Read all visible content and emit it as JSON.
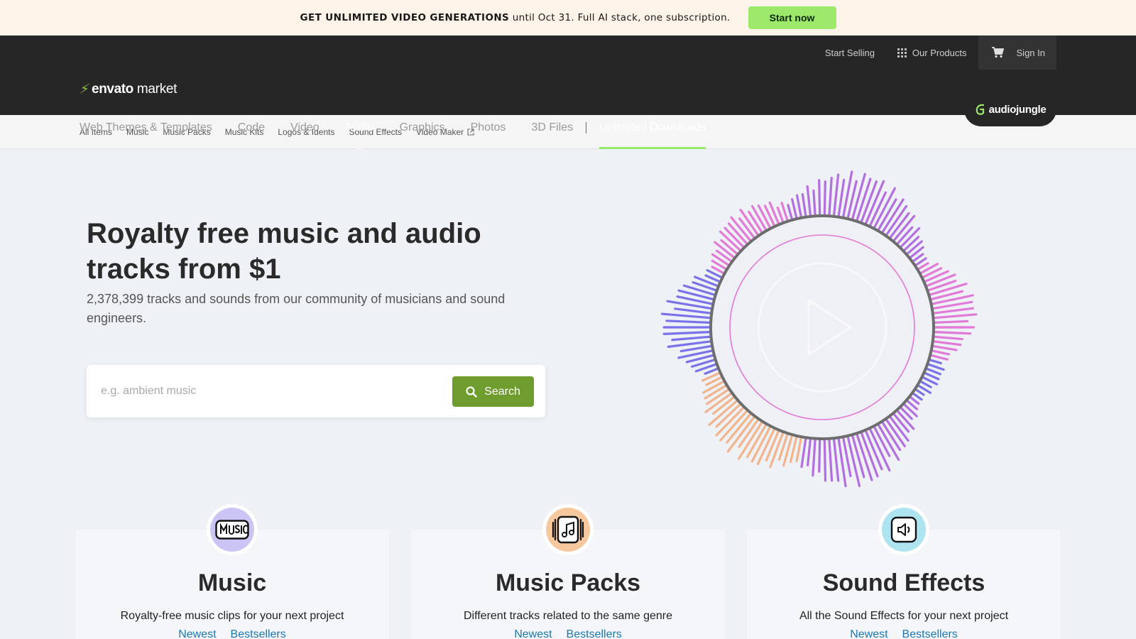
{
  "promo": {
    "headline": "GET UNLIMITED VIDEO GENERATIONS",
    "detail": "until Oct 31. Full AI stack, one subscription.",
    "cta": "Start now"
  },
  "brand": {
    "logo_bold": "envato",
    "logo_light": "market",
    "site_badge": "audiojungle"
  },
  "top_links": {
    "start_selling": "Start Selling",
    "our_products": "Our Products",
    "sign_in": "Sign In"
  },
  "main_nav": [
    {
      "label": "Web Themes & Templates"
    },
    {
      "label": "Code"
    },
    {
      "label": "Video"
    },
    {
      "label": "Audio",
      "active": true
    },
    {
      "label": "Graphics"
    },
    {
      "label": "Photos"
    },
    {
      "label": "3D Files"
    },
    {
      "label": "Unlimited Downloads"
    }
  ],
  "sub_nav": [
    "All Items",
    "Music",
    "Music Packs",
    "Music Kits",
    "Logos & Idents",
    "Sound Effects",
    "Video Maker"
  ],
  "hero": {
    "title": "Royalty free music and audio tracks from $1",
    "subtitle": "2,378,399 tracks and sounds from our community of musicians and sound engineers.",
    "search_placeholder": "e.g. ambient music",
    "search_button": "Search"
  },
  "categories": [
    {
      "icon": "music-label-icon",
      "title": "Music",
      "description": "Royalty-free music clips for your next project",
      "link_newest": "Newest",
      "link_best": "Bestsellers"
    },
    {
      "icon": "music-pack-icon",
      "title": "Music Packs",
      "description": "Different tracks related to the same genre",
      "link_newest": "Newest",
      "link_best": "Bestsellers"
    },
    {
      "icon": "sound-effect-icon",
      "title": "Sound Effects",
      "description": "All the Sound Effects for your next project",
      "link_newest": "Newest",
      "link_best": "Bestsellers"
    }
  ],
  "colors": {
    "promo_bg": "#fdf3e8",
    "promo_cta": "#9ce86b",
    "header_bg": "#262626",
    "search_btn": "#6e9d2d",
    "link": "#1a78b4",
    "wave_purple": "#b36ee0",
    "wave_pink": "#e27ad8",
    "wave_blue": "#7b72e9",
    "wave_peach": "#f2b48c"
  }
}
